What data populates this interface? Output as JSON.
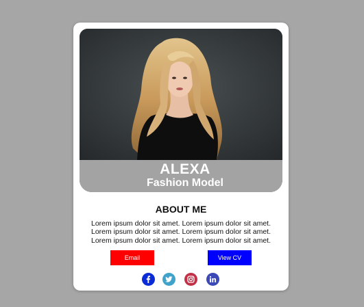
{
  "profile": {
    "name": "ALEXA",
    "title": "Fashion Model"
  },
  "about": {
    "heading": "ABOUT ME",
    "text": "Lorem ipsum dolor sit amet. Lorem ipsum dolor sit amet. Lorem ipsum dolor sit amet. Lorem ipsum dolor sit amet. Lorem ipsum dolor sit amet. Lorem ipsum dolor sit amet."
  },
  "buttons": {
    "email": "Email",
    "cv": "View CV"
  },
  "socials": [
    {
      "icon": "facebook-icon",
      "color": "#0a2bd6"
    },
    {
      "icon": "twitter-icon",
      "color": "#41a3c9"
    },
    {
      "icon": "instagram-icon",
      "color": "#c13248"
    },
    {
      "icon": "linkedin-icon",
      "color": "#3a49b5"
    }
  ],
  "colors": {
    "background": "#a6a6a6",
    "card": "#ffffff",
    "name_band": "#a3a3a3",
    "email_button": "#ff0000",
    "cv_button": "#0000ff"
  }
}
